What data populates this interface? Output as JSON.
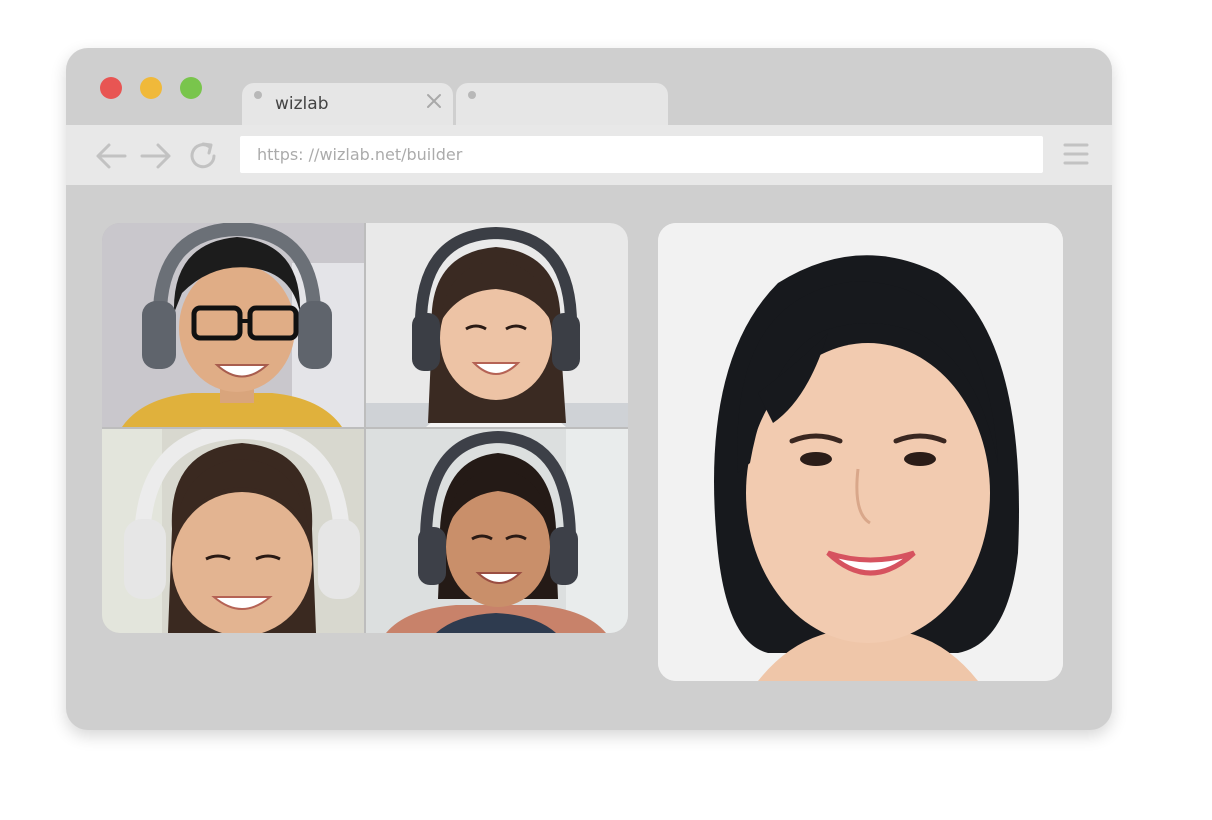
{
  "browser": {
    "tabs": [
      {
        "title": "wizlab",
        "active": true
      },
      {
        "title": "",
        "active": false
      }
    ],
    "address_bar": {
      "url": "https: //wizlab.net/builder"
    },
    "nav_icons": [
      "arrow-left-icon",
      "arrow-right-icon",
      "reload-icon",
      "hamburger-menu-icon"
    ],
    "traffic_lights": {
      "red": "#e85553",
      "yellow": "#f0b93a",
      "green": "#79c54c"
    }
  },
  "video_call": {
    "participants": [
      {
        "role": "student",
        "position": "top-left"
      },
      {
        "role": "student",
        "position": "top-right"
      },
      {
        "role": "student",
        "position": "bottom-left"
      },
      {
        "role": "student",
        "position": "bottom-right"
      }
    ],
    "main_speaker": {
      "role": "teacher"
    }
  },
  "colors": {
    "window_bg": "#cfcfcf",
    "toolbar_bg": "#e8e8e8",
    "tab_bg": "#e6e6e6"
  }
}
